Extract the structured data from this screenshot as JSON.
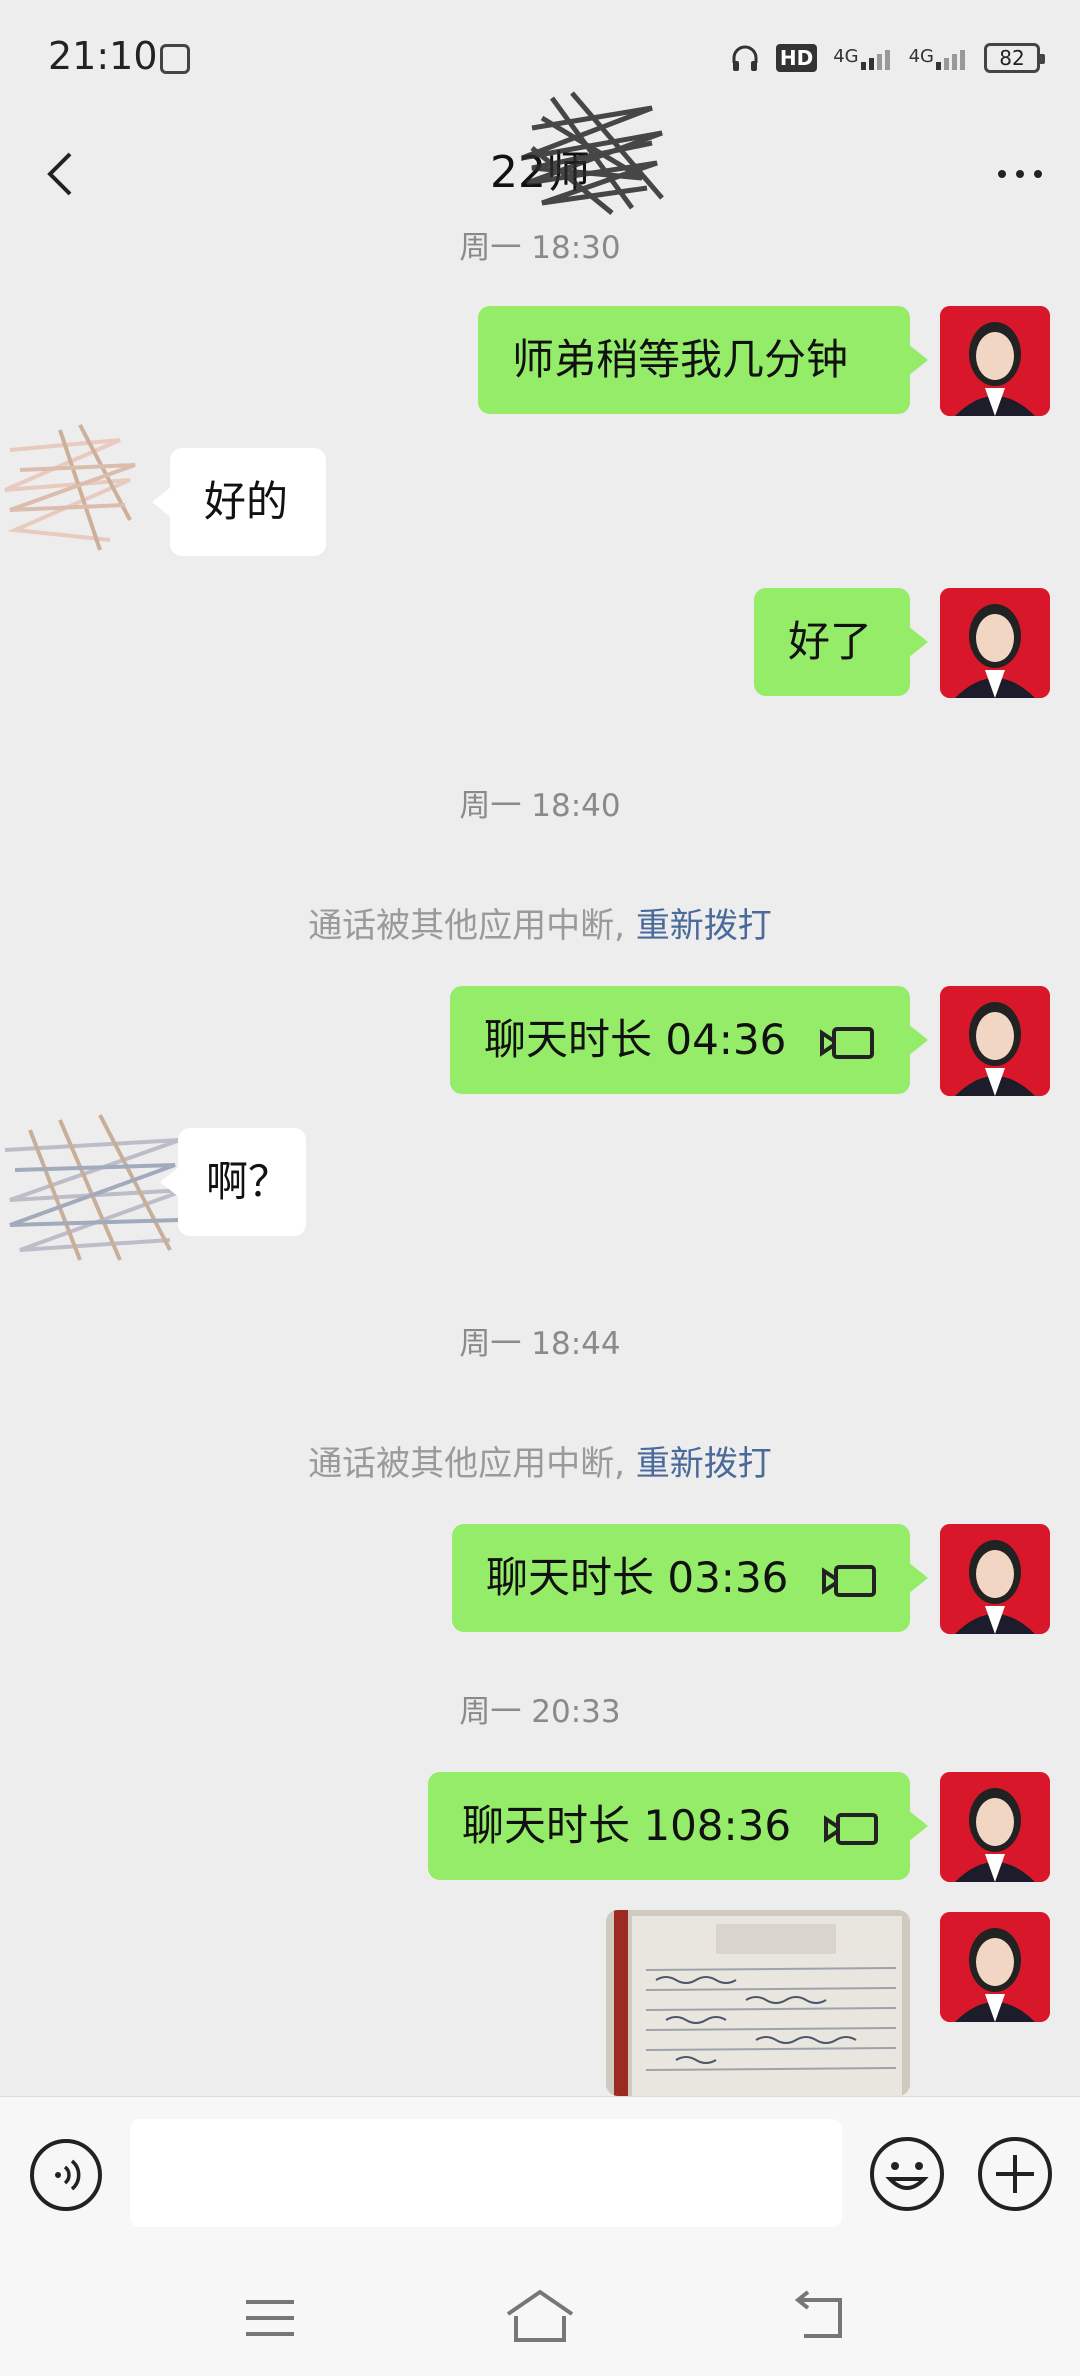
{
  "status_bar": {
    "time": "21:10",
    "battery": "82",
    "network_1": "4G",
    "network_2": "4G",
    "hd_label": "HD"
  },
  "header": {
    "title": "22师"
  },
  "messages": {
    "ts0": "周一 18:30",
    "m1": "师弟稍等我几分钟",
    "m2": "好的",
    "m3": "好了",
    "ts1": "周一 18:40",
    "sys1_text": "通话被其他应用中断,",
    "sys1_link": "重新拨打",
    "m4": "聊天时长 04:36",
    "m5": "啊？",
    "ts2": "周一 18:44",
    "sys2_text": "通话被其他应用中断,",
    "sys2_link": "重新拨打",
    "m6": "聊天时长 03:36",
    "ts3": "周一 20:33",
    "m7": "聊天时长 108:36"
  },
  "input": {
    "placeholder": ""
  },
  "colors": {
    "bubble_me": "#95ec69",
    "background": "#ededed",
    "avatar_bg": "#d8182a",
    "link": "#4a6a9b"
  }
}
